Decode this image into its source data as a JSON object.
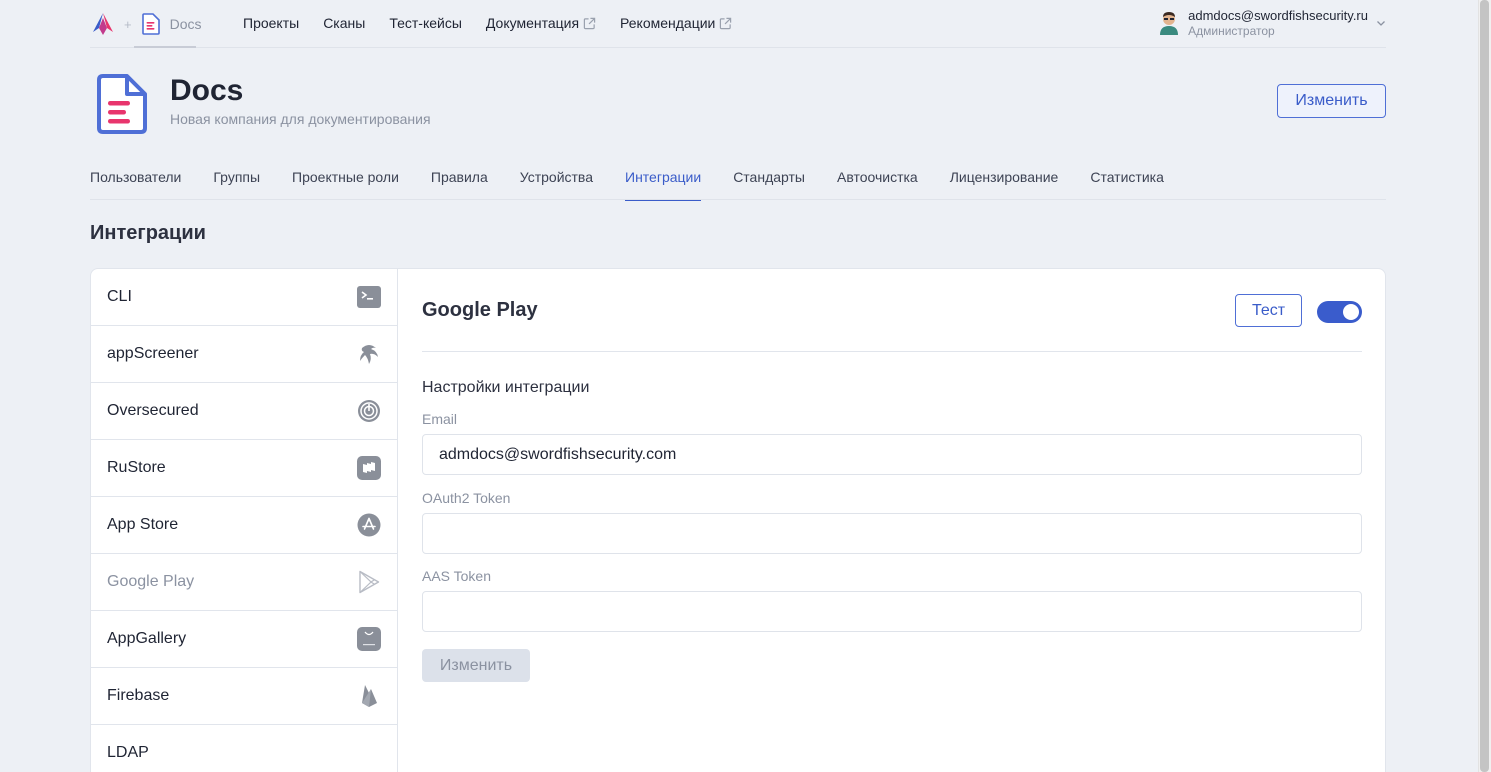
{
  "brand": {
    "doc_label": "Docs"
  },
  "nav": {
    "items": [
      {
        "label": "Проекты"
      },
      {
        "label": "Сканы"
      },
      {
        "label": "Тест-кейсы"
      },
      {
        "label": "Документация",
        "icon": "external-link-icon"
      },
      {
        "label": "Рекомендации",
        "icon": "external-link-icon"
      }
    ]
  },
  "user": {
    "email": "admdocs@swordfishsecurity.ru",
    "role": "Администратор"
  },
  "company": {
    "name": "Docs",
    "description": "Новая компания для документирования",
    "edit_label": "Изменить"
  },
  "tabs": [
    {
      "label": "Пользователи"
    },
    {
      "label": "Группы"
    },
    {
      "label": "Проектные роли"
    },
    {
      "label": "Правила"
    },
    {
      "label": "Устройства"
    },
    {
      "label": "Интеграции",
      "active": true
    },
    {
      "label": "Стандарты"
    },
    {
      "label": "Автоочистка"
    },
    {
      "label": "Лицензирование"
    },
    {
      "label": "Статистика"
    }
  ],
  "section_title": "Интеграции",
  "integrations": [
    {
      "label": "CLI",
      "icon": "terminal-icon"
    },
    {
      "label": "appScreener",
      "icon": "appscreener-icon"
    },
    {
      "label": "Oversecured",
      "icon": "oversecured-icon"
    },
    {
      "label": "RuStore",
      "icon": "rustore-icon"
    },
    {
      "label": "App Store",
      "icon": "app-store-icon"
    },
    {
      "label": "Google Play",
      "icon": "google-play-icon",
      "active": true
    },
    {
      "label": "AppGallery",
      "icon": "appgallery-icon"
    },
    {
      "label": "Firebase",
      "icon": "firebase-icon"
    },
    {
      "label": "LDAP",
      "icon": "ldap-icon"
    }
  ],
  "detail": {
    "title": "Google Play",
    "test_label": "Тест",
    "enabled": true,
    "settings_title": "Настройки интеграции",
    "email_label": "Email",
    "email_value": "admdocs@swordfishsecurity.com",
    "oauth_label": "OAuth2 Token",
    "oauth_value": "",
    "aas_label": "AAS Token",
    "aas_value": "",
    "save_label": "Изменить"
  },
  "colors": {
    "accent": "#3a5cc9",
    "background": "#edf0f5",
    "brand_pink": "#e8356d"
  }
}
